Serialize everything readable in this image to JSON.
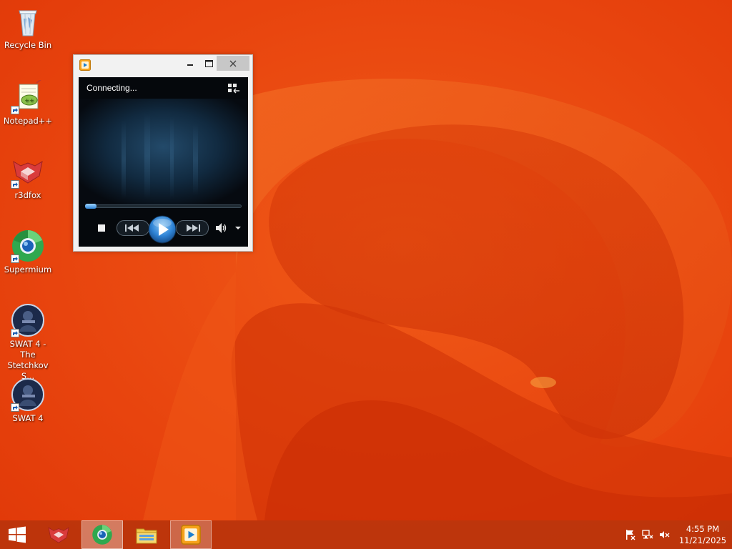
{
  "desktop": {
    "icons": [
      {
        "label": "Recycle Bin",
        "icon": "recycle-bin-icon",
        "shortcut": false
      },
      {
        "label": "Notepad++",
        "icon": "notepad-plus-plus-icon",
        "shortcut": true
      },
      {
        "label": "r3dfox",
        "icon": "r3dfox-icon",
        "shortcut": true
      },
      {
        "label": "Supermium",
        "icon": "supermium-icon",
        "shortcut": true
      },
      {
        "label": "SWAT 4 - The Stetchkov S...",
        "icon": "swat4-tss-icon",
        "shortcut": true
      },
      {
        "label": "SWAT 4",
        "icon": "swat4-icon",
        "shortcut": true
      }
    ]
  },
  "player": {
    "app": "Windows Media Player",
    "status": "Connecting...",
    "seek_progress": 0.0,
    "accent_color": "#2f84d6",
    "controls": [
      "stop-icon",
      "previous-icon",
      "play-icon",
      "next-icon",
      "volume-icon",
      "dropdown-arrow-icon"
    ],
    "title_buttons": [
      "minimize-icon",
      "maximize-icon",
      "close-icon"
    ]
  },
  "taskbar": {
    "start_icon": "windows-logo-icon",
    "pinned": [
      {
        "name": "r3dfox",
        "icon": "r3dfox-icon"
      },
      {
        "name": "Supermium",
        "icon": "supermium-icon",
        "active": true
      },
      {
        "name": "File Explorer",
        "icon": "folder-icon"
      },
      {
        "name": "Windows Media Player",
        "icon": "media-player-icon",
        "active": true
      }
    ],
    "tray": [
      "action-center-flag-icon",
      "network-icon",
      "volume-muted-icon"
    ],
    "clock": {
      "time": "4:55 PM",
      "date": "11/21/2025"
    }
  },
  "colors": {
    "wallpaper": "#e8400c",
    "taskbar": "#ba340c"
  }
}
